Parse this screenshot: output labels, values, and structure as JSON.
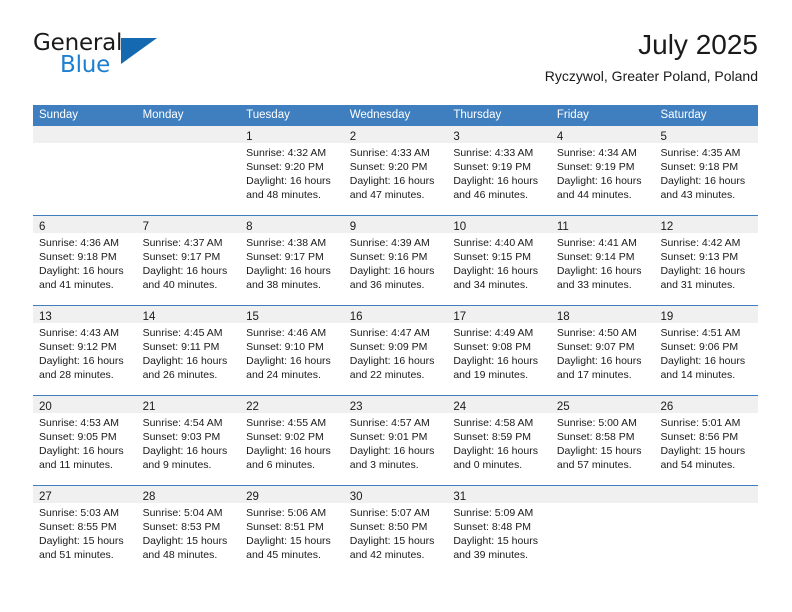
{
  "brand": {
    "name_part1": "General",
    "name_part2": "Blue",
    "triangle_color": "#1569b0",
    "blue_color": "#1c7fd1"
  },
  "header": {
    "title": "July 2025",
    "subtitle": "Ryczywol, Greater Poland, Poland"
  },
  "calendar": {
    "header_bg": "#3f7fbf",
    "daynum_bg": "#f0f0f0",
    "day_names": [
      "Sunday",
      "Monday",
      "Tuesday",
      "Wednesday",
      "Thursday",
      "Friday",
      "Saturday"
    ],
    "weeks": [
      [
        {
          "day": "",
          "sunrise": "",
          "sunset": "",
          "daylight_line1": "",
          "daylight_line2": ""
        },
        {
          "day": "",
          "sunrise": "",
          "sunset": "",
          "daylight_line1": "",
          "daylight_line2": ""
        },
        {
          "day": "1",
          "sunrise": "Sunrise: 4:32 AM",
          "sunset": "Sunset: 9:20 PM",
          "daylight_line1": "Daylight: 16 hours",
          "daylight_line2": "and 48 minutes."
        },
        {
          "day": "2",
          "sunrise": "Sunrise: 4:33 AM",
          "sunset": "Sunset: 9:20 PM",
          "daylight_line1": "Daylight: 16 hours",
          "daylight_line2": "and 47 minutes."
        },
        {
          "day": "3",
          "sunrise": "Sunrise: 4:33 AM",
          "sunset": "Sunset: 9:19 PM",
          "daylight_line1": "Daylight: 16 hours",
          "daylight_line2": "and 46 minutes."
        },
        {
          "day": "4",
          "sunrise": "Sunrise: 4:34 AM",
          "sunset": "Sunset: 9:19 PM",
          "daylight_line1": "Daylight: 16 hours",
          "daylight_line2": "and 44 minutes."
        },
        {
          "day": "5",
          "sunrise": "Sunrise: 4:35 AM",
          "sunset": "Sunset: 9:18 PM",
          "daylight_line1": "Daylight: 16 hours",
          "daylight_line2": "and 43 minutes."
        }
      ],
      [
        {
          "day": "6",
          "sunrise": "Sunrise: 4:36 AM",
          "sunset": "Sunset: 9:18 PM",
          "daylight_line1": "Daylight: 16 hours",
          "daylight_line2": "and 41 minutes."
        },
        {
          "day": "7",
          "sunrise": "Sunrise: 4:37 AM",
          "sunset": "Sunset: 9:17 PM",
          "daylight_line1": "Daylight: 16 hours",
          "daylight_line2": "and 40 minutes."
        },
        {
          "day": "8",
          "sunrise": "Sunrise: 4:38 AM",
          "sunset": "Sunset: 9:17 PM",
          "daylight_line1": "Daylight: 16 hours",
          "daylight_line2": "and 38 minutes."
        },
        {
          "day": "9",
          "sunrise": "Sunrise: 4:39 AM",
          "sunset": "Sunset: 9:16 PM",
          "daylight_line1": "Daylight: 16 hours",
          "daylight_line2": "and 36 minutes."
        },
        {
          "day": "10",
          "sunrise": "Sunrise: 4:40 AM",
          "sunset": "Sunset: 9:15 PM",
          "daylight_line1": "Daylight: 16 hours",
          "daylight_line2": "and 34 minutes."
        },
        {
          "day": "11",
          "sunrise": "Sunrise: 4:41 AM",
          "sunset": "Sunset: 9:14 PM",
          "daylight_line1": "Daylight: 16 hours",
          "daylight_line2": "and 33 minutes."
        },
        {
          "day": "12",
          "sunrise": "Sunrise: 4:42 AM",
          "sunset": "Sunset: 9:13 PM",
          "daylight_line1": "Daylight: 16 hours",
          "daylight_line2": "and 31 minutes."
        }
      ],
      [
        {
          "day": "13",
          "sunrise": "Sunrise: 4:43 AM",
          "sunset": "Sunset: 9:12 PM",
          "daylight_line1": "Daylight: 16 hours",
          "daylight_line2": "and 28 minutes."
        },
        {
          "day": "14",
          "sunrise": "Sunrise: 4:45 AM",
          "sunset": "Sunset: 9:11 PM",
          "daylight_line1": "Daylight: 16 hours",
          "daylight_line2": "and 26 minutes."
        },
        {
          "day": "15",
          "sunrise": "Sunrise: 4:46 AM",
          "sunset": "Sunset: 9:10 PM",
          "daylight_line1": "Daylight: 16 hours",
          "daylight_line2": "and 24 minutes."
        },
        {
          "day": "16",
          "sunrise": "Sunrise: 4:47 AM",
          "sunset": "Sunset: 9:09 PM",
          "daylight_line1": "Daylight: 16 hours",
          "daylight_line2": "and 22 minutes."
        },
        {
          "day": "17",
          "sunrise": "Sunrise: 4:49 AM",
          "sunset": "Sunset: 9:08 PM",
          "daylight_line1": "Daylight: 16 hours",
          "daylight_line2": "and 19 minutes."
        },
        {
          "day": "18",
          "sunrise": "Sunrise: 4:50 AM",
          "sunset": "Sunset: 9:07 PM",
          "daylight_line1": "Daylight: 16 hours",
          "daylight_line2": "and 17 minutes."
        },
        {
          "day": "19",
          "sunrise": "Sunrise: 4:51 AM",
          "sunset": "Sunset: 9:06 PM",
          "daylight_line1": "Daylight: 16 hours",
          "daylight_line2": "and 14 minutes."
        }
      ],
      [
        {
          "day": "20",
          "sunrise": "Sunrise: 4:53 AM",
          "sunset": "Sunset: 9:05 PM",
          "daylight_line1": "Daylight: 16 hours",
          "daylight_line2": "and 11 minutes."
        },
        {
          "day": "21",
          "sunrise": "Sunrise: 4:54 AM",
          "sunset": "Sunset: 9:03 PM",
          "daylight_line1": "Daylight: 16 hours",
          "daylight_line2": "and 9 minutes."
        },
        {
          "day": "22",
          "sunrise": "Sunrise: 4:55 AM",
          "sunset": "Sunset: 9:02 PM",
          "daylight_line1": "Daylight: 16 hours",
          "daylight_line2": "and 6 minutes."
        },
        {
          "day": "23",
          "sunrise": "Sunrise: 4:57 AM",
          "sunset": "Sunset: 9:01 PM",
          "daylight_line1": "Daylight: 16 hours",
          "daylight_line2": "and 3 minutes."
        },
        {
          "day": "24",
          "sunrise": "Sunrise: 4:58 AM",
          "sunset": "Sunset: 8:59 PM",
          "daylight_line1": "Daylight: 16 hours",
          "daylight_line2": "and 0 minutes."
        },
        {
          "day": "25",
          "sunrise": "Sunrise: 5:00 AM",
          "sunset": "Sunset: 8:58 PM",
          "daylight_line1": "Daylight: 15 hours",
          "daylight_line2": "and 57 minutes."
        },
        {
          "day": "26",
          "sunrise": "Sunrise: 5:01 AM",
          "sunset": "Sunset: 8:56 PM",
          "daylight_line1": "Daylight: 15 hours",
          "daylight_line2": "and 54 minutes."
        }
      ],
      [
        {
          "day": "27",
          "sunrise": "Sunrise: 5:03 AM",
          "sunset": "Sunset: 8:55 PM",
          "daylight_line1": "Daylight: 15 hours",
          "daylight_line2": "and 51 minutes."
        },
        {
          "day": "28",
          "sunrise": "Sunrise: 5:04 AM",
          "sunset": "Sunset: 8:53 PM",
          "daylight_line1": "Daylight: 15 hours",
          "daylight_line2": "and 48 minutes."
        },
        {
          "day": "29",
          "sunrise": "Sunrise: 5:06 AM",
          "sunset": "Sunset: 8:51 PM",
          "daylight_line1": "Daylight: 15 hours",
          "daylight_line2": "and 45 minutes."
        },
        {
          "day": "30",
          "sunrise": "Sunrise: 5:07 AM",
          "sunset": "Sunset: 8:50 PM",
          "daylight_line1": "Daylight: 15 hours",
          "daylight_line2": "and 42 minutes."
        },
        {
          "day": "31",
          "sunrise": "Sunrise: 5:09 AM",
          "sunset": "Sunset: 8:48 PM",
          "daylight_line1": "Daylight: 15 hours",
          "daylight_line2": "and 39 minutes."
        },
        {
          "day": "",
          "sunrise": "",
          "sunset": "",
          "daylight_line1": "",
          "daylight_line2": ""
        },
        {
          "day": "",
          "sunrise": "",
          "sunset": "",
          "daylight_line1": "",
          "daylight_line2": ""
        }
      ]
    ]
  }
}
